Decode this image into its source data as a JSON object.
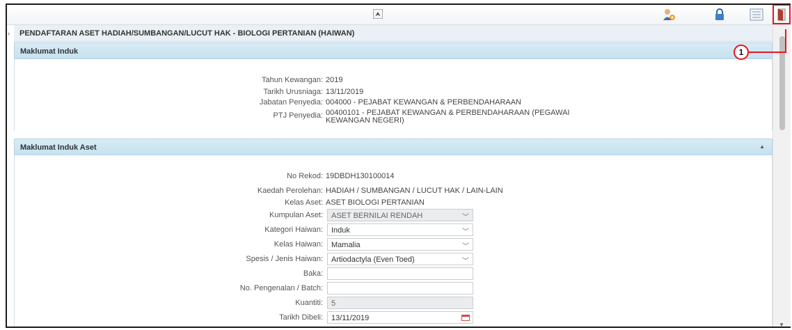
{
  "toolbar": {
    "collapse_glyph": "⮝",
    "icons": [
      "user-settings-icon",
      "lock-icon",
      "list-view-icon",
      "exit-door-icon"
    ]
  },
  "page": {
    "title": "PENDAFTARAN ASET HADIAH/SUMBANGAN/LUCUT HAK - BIOLOGI PERTANIAN (HAIWAN)"
  },
  "induk": {
    "header": "Maklumat Induk",
    "fields": [
      {
        "label": "Tahun Kewangan",
        "value": "2019"
      },
      {
        "label": "Tarikh Urusniaga",
        "value": "13/11/2019"
      },
      {
        "label": "Jabatan Penyedia",
        "value": "004000 - PEJABAT KEWANGAN & PERBENDAHARAAN"
      },
      {
        "label": "PTJ Penyedia",
        "value": "00400101 - PEJABAT KEWANGAN & PERBENDAHARAAN (PEGAWAI KEWANGAN NEGERI)"
      }
    ]
  },
  "aset": {
    "header": "Maklumat Induk Aset",
    "no_rekod": {
      "label": "No Rekod",
      "value": "19DBDH130100014"
    },
    "kaedah": {
      "label": "Kaedah Perolehan",
      "value": "HADIAH / SUMBANGAN / LUCUT HAK / LAIN-LAIN"
    },
    "kelas_aset": {
      "label": "Kelas Aset",
      "value": "ASET BIOLOGI PERTANIAN"
    },
    "kumpulan": {
      "label": "Kumpulan Aset",
      "value": "ASET BERNILAI RENDAH"
    },
    "kategori": {
      "label": "Kategori Haiwan",
      "value": "Induk"
    },
    "kelas_haiwan": {
      "label": "Kelas Haiwan",
      "value": "Mamalia"
    },
    "spesis": {
      "label": "Spesis / Jenis Haiwan",
      "value": "Artiodactyla (Even Toed)"
    },
    "baka": {
      "label": "Baka",
      "value": ""
    },
    "pengenalan": {
      "label": "No. Pengenalan / Batch",
      "value": ""
    },
    "kuantiti": {
      "label": "Kuantiti",
      "value": "5"
    },
    "tarikh_dibeli": {
      "label": "Tarikh Dibeli",
      "value": "13/11/2019"
    }
  },
  "annotation": {
    "number": "1"
  },
  "colors": {
    "section_header": "#c5e1f0",
    "highlight": "#e8141e"
  }
}
